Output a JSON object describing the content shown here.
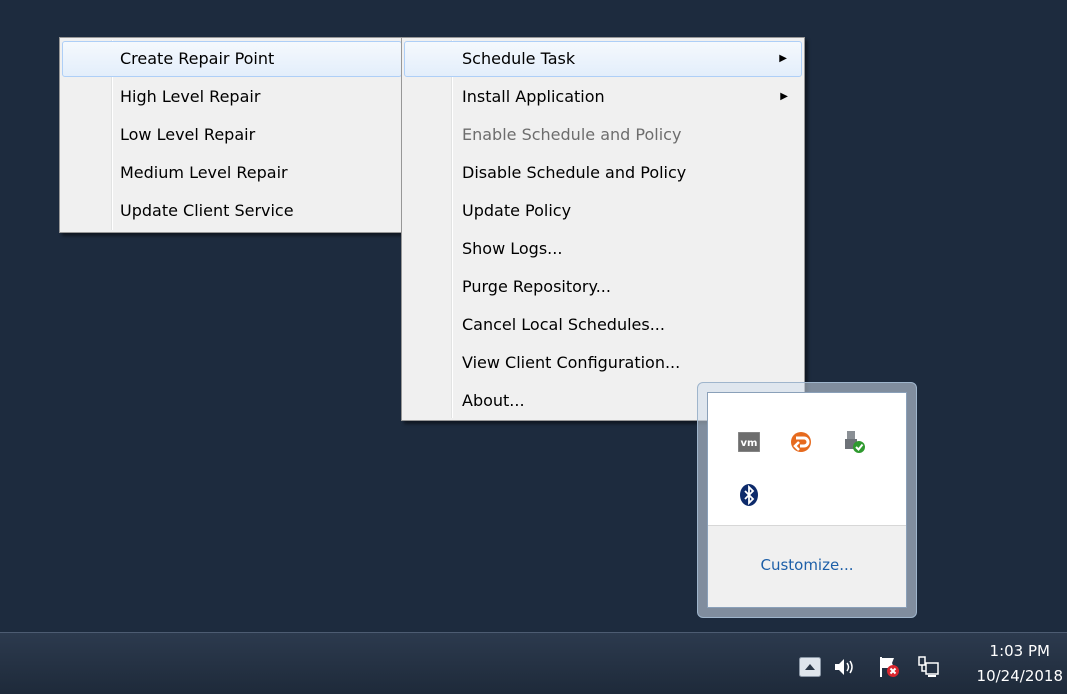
{
  "left_menu": {
    "items": [
      {
        "label": "Create Repair Point",
        "highlighted": true
      },
      {
        "label": "High Level Repair"
      },
      {
        "label": "Low Level Repair"
      },
      {
        "label": "Medium Level Repair"
      },
      {
        "label": "Update Client Service"
      }
    ]
  },
  "right_menu": {
    "items": [
      {
        "label": "Schedule Task",
        "submenu": true
      },
      {
        "label": "Install Application",
        "submenu": true
      },
      {
        "label": "Enable Schedule and Policy",
        "disabled": true
      },
      {
        "label": "Disable Schedule and Policy"
      },
      {
        "label": "Update Policy"
      },
      {
        "label": "Show Logs..."
      },
      {
        "label": "Purge Repository..."
      },
      {
        "label": "Cancel Local Schedules..."
      },
      {
        "label": "View Client Configuration..."
      },
      {
        "label": "About..."
      }
    ],
    "submenu_arrow": "▶"
  },
  "tray_overflow": {
    "icons": [
      "vmware-icon",
      "repair-client-icon",
      "safely-remove-hardware-icon",
      "bluetooth-icon"
    ],
    "vm_text": "vm",
    "customize_label": "Customize..."
  },
  "taskbar": {
    "clock_time": "1:03 PM",
    "clock_date": "10/24/2018",
    "icons": [
      "show-hidden-icons-icon",
      "volume-icon",
      "action-center-flag-icon",
      "network-icon"
    ]
  },
  "colors": {
    "desktop": "#1d2b3e",
    "menu_bg": "#f0f0f0",
    "highlight_border": "#aecff7",
    "link": "#1d5fa8"
  }
}
